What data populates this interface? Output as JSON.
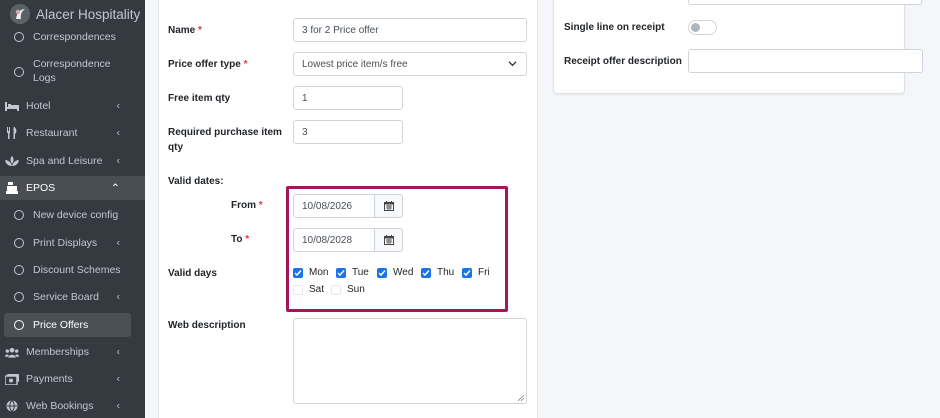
{
  "brand": {
    "name": "Alacer Hospitality"
  },
  "sidebar": {
    "items": [
      {
        "label": "Correspondences",
        "icon": "circle-icon",
        "type": "sub"
      },
      {
        "label": "Correspondence Logs",
        "icon": "circle-icon",
        "type": "sub"
      },
      {
        "label": "Hotel",
        "icon": "bed-icon",
        "type": "section",
        "caret": "‹"
      },
      {
        "label": "Restaurant",
        "icon": "utensils-icon",
        "type": "section",
        "caret": "‹"
      },
      {
        "label": "Spa and Leisure",
        "icon": "spa-icon",
        "type": "section",
        "caret": "‹"
      },
      {
        "label": "EPOS",
        "icon": "cash-register-icon",
        "type": "section",
        "caret": "⌃"
      },
      {
        "label": "New device config",
        "icon": "circle-icon",
        "type": "sub"
      },
      {
        "label": "Print Displays",
        "icon": "circle-icon",
        "type": "sub",
        "caret": "‹"
      },
      {
        "label": "Discount Schemes",
        "icon": "circle-icon",
        "type": "sub"
      },
      {
        "label": "Service Board",
        "icon": "circle-icon",
        "type": "sub",
        "caret": "‹"
      },
      {
        "label": "Price Offers",
        "icon": "circle-icon",
        "type": "sub"
      },
      {
        "label": "Memberships",
        "icon": "users-icon",
        "type": "section",
        "caret": "‹"
      },
      {
        "label": "Payments",
        "icon": "money-icon",
        "type": "section",
        "caret": "‹"
      },
      {
        "label": "Web Bookings",
        "icon": "globe-icon",
        "type": "section",
        "caret": "‹"
      }
    ]
  },
  "form": {
    "name": {
      "label": "Name",
      "required_mark": "*",
      "value": "3 for 2 Price offer"
    },
    "offer_type": {
      "label": "Price offer type",
      "required_mark": "*",
      "value": "Lowest price item/s free"
    },
    "free_qty": {
      "label": "Free item qty",
      "value": "1"
    },
    "required_qty": {
      "label": "Required purchase item qty",
      "value": "3"
    },
    "valid_dates": {
      "label": "Valid dates:"
    },
    "from": {
      "label": "From",
      "required_mark": "*",
      "value": "10/08/2026"
    },
    "to": {
      "label": "To",
      "required_mark": "*",
      "value": "10/08/2028"
    },
    "valid_days": {
      "label": "Valid days",
      "days": [
        {
          "label": "Mon",
          "checked": true
        },
        {
          "label": "Tue",
          "checked": true
        },
        {
          "label": "Wed",
          "checked": true
        },
        {
          "label": "Thu",
          "checked": true
        },
        {
          "label": "Fri",
          "checked": true
        },
        {
          "label": "Sat",
          "checked": false
        },
        {
          "label": "Sun",
          "checked": false
        }
      ]
    },
    "web_description": {
      "label": "Web description",
      "value": ""
    }
  },
  "right": {
    "single_line": {
      "label": "Single line on receipt",
      "checked": false
    },
    "receipt_desc": {
      "label": "Receipt offer description",
      "value": ""
    }
  },
  "colors": {
    "sidebar": "#343a40",
    "highlight": "#a0175a",
    "checkbox": "#1a73e8",
    "required": "#dc3545"
  }
}
